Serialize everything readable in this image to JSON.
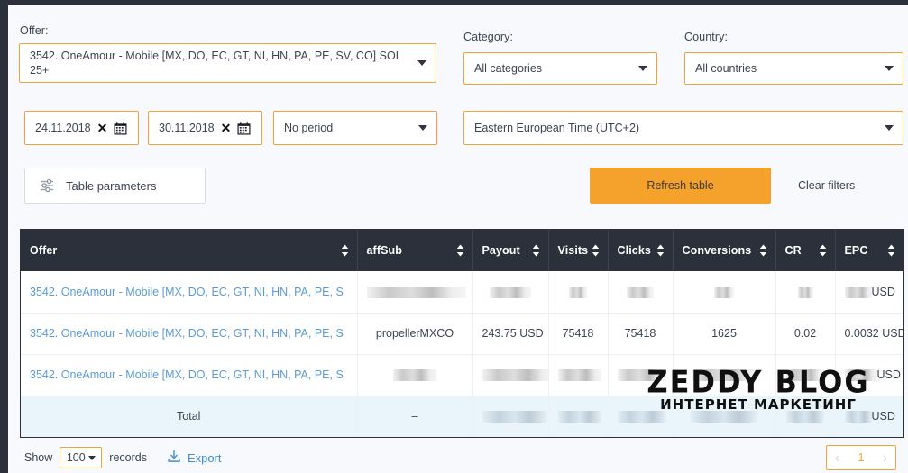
{
  "filters": {
    "offer_label": "Offer:",
    "offer_value": "3542. OneAmour - Mobile [MX, DO, EC, GT, NI, HN, PA, PE, SV, CO] SOI 25+",
    "category_label": "Category:",
    "category_value": "All categories",
    "country_label": "Country:",
    "country_value": "All countries",
    "date_from": "24.11.2018",
    "date_to": "30.11.2018",
    "period_value": "No period",
    "timezone_value": "Eastern European Time (UTC+2)"
  },
  "actions": {
    "table_parameters": "Table parameters",
    "refresh_table": "Refresh table",
    "clear_filters": "Clear filters",
    "accent_color": "#f5a22c",
    "border_color": "#f0a33c"
  },
  "table": {
    "columns": [
      {
        "key": "offer",
        "label": "Offer",
        "sortable": true
      },
      {
        "key": "affsub",
        "label": "affSub",
        "sortable": true
      },
      {
        "key": "payout",
        "label": "Payout",
        "sortable": true
      },
      {
        "key": "visits",
        "label": "Visits",
        "sortable": true
      },
      {
        "key": "clicks",
        "label": "Clicks",
        "sortable": true
      },
      {
        "key": "conversions",
        "label": "Conversions",
        "sortable": true
      },
      {
        "key": "cr",
        "label": "CR",
        "sortable": true
      },
      {
        "key": "epc",
        "label": "EPC",
        "sortable": true
      }
    ],
    "rows": [
      {
        "offer": "3542. OneAmour - Mobile [MX, DO, EC, GT, NI, HN, PA, PE, S",
        "affsub": "",
        "payout": "",
        "visits": "",
        "clicks": "",
        "conversions": "",
        "cr": "",
        "epc": "USD",
        "redacted": true
      },
      {
        "offer": "3542. OneAmour - Mobile [MX, DO, EC, GT, NI, HN, PA, PE, S",
        "affsub": "propellerMXCO",
        "payout": "243.75 USD",
        "visits": "75418",
        "clicks": "75418",
        "conversions": "1625",
        "cr": "0.02",
        "epc": "0.0032 USD",
        "redacted": false
      },
      {
        "offer": "3542. OneAmour - Mobile [MX, DO, EC, GT, NI, HN, PA, PE, S",
        "affsub": "",
        "payout": "",
        "visits": "",
        "clicks": "",
        "conversions": "",
        "cr": "",
        "epc": "USD",
        "redacted": true
      }
    ],
    "total_row": {
      "offer": "Total",
      "affsub": "–",
      "payout": "",
      "visits": "",
      "clicks": "",
      "conversions": "",
      "cr": "",
      "epc": "USD",
      "redacted": true
    }
  },
  "footer": {
    "show_label": "Show",
    "records_per_page": "100",
    "records_label": "records",
    "export_label": "Export",
    "page_prev": "‹",
    "page_current": "1",
    "page_next": "›"
  },
  "watermark": {
    "main": "ZEDDY BLOG",
    "sub": "ИНТЕРНЕТ МАРКЕТИНГ"
  }
}
